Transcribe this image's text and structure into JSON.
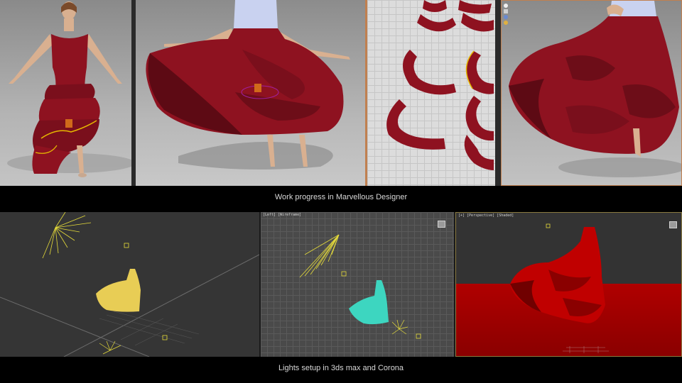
{
  "top_section": {
    "caption": "Work progress in Marvellous Designer",
    "panels": [
      "dress-front",
      "dress-swirl",
      "pattern-pieces",
      "dress-closeup"
    ],
    "toolbar_icons": [
      "sun-icon",
      "person-icon",
      "moon-icon",
      "lightbulb-icon"
    ]
  },
  "bottom_section": {
    "caption": "Lights setup in 3ds max and Corona",
    "viewports": [
      {
        "label": ""
      },
      {
        "label": "[Left] [Wireframe]"
      },
      {
        "label": "[+] [Perspective] [Shaded]"
      }
    ]
  },
  "colors": {
    "fabric": "#8e1220",
    "fabric_dark": "#5d0a14",
    "skin": "#d9b090",
    "bodice": "#c9d2f0",
    "light_gizmo": "#e6dc3a",
    "cyan_mesh": "#3dd6c0",
    "red_render": "#b00000"
  }
}
